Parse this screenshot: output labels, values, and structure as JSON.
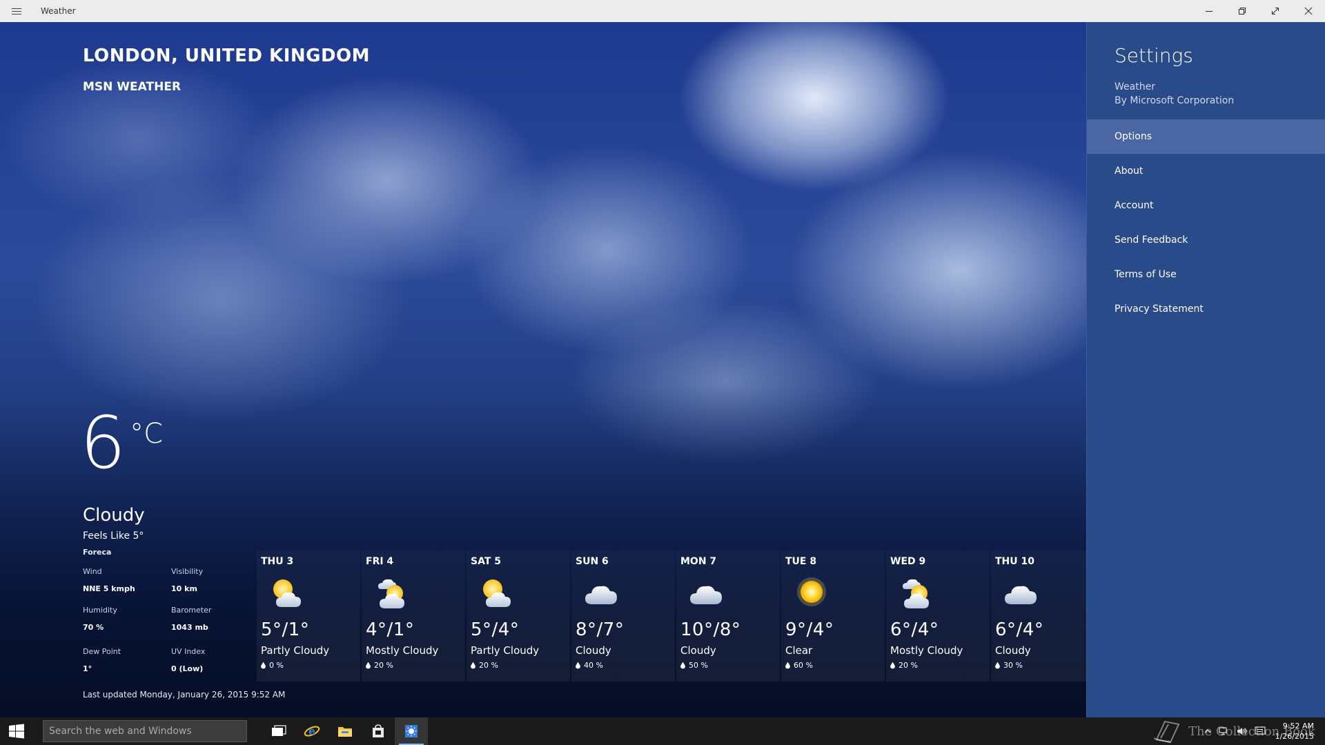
{
  "titlebar": {
    "app_title": "Weather"
  },
  "location": {
    "name": "LONDON, UNITED KINGDOM",
    "provider": "MSN WEATHER"
  },
  "current": {
    "temperature": "6",
    "unit": "°C",
    "condition": "Cloudy",
    "feels_like": "Feels Like 5°",
    "source": "Foreca",
    "details": [
      {
        "label": "Wind",
        "value": "NNE 5 kmph"
      },
      {
        "label": "Visibility",
        "value": "10 km"
      },
      {
        "label": "Humidity",
        "value": "70 %"
      },
      {
        "label": "Barometer",
        "value": "1043 mb"
      },
      {
        "label": "Dew Point",
        "value": "1°"
      },
      {
        "label": "UV Index",
        "value": "0 (Low)"
      }
    ]
  },
  "forecast": [
    {
      "day": "THU 3",
      "temp": "5°/1°",
      "condition": "Partly Cloudy",
      "precip": "0 %",
      "icon": "partly-cloudy-icon"
    },
    {
      "day": "FRI 4",
      "temp": "4°/1°",
      "condition": "Mostly Cloudy",
      "precip": "20 %",
      "icon": "mostly-cloudy-icon"
    },
    {
      "day": "SAT 5",
      "temp": "5°/4°",
      "condition": "Partly Cloudy",
      "precip": "20 %",
      "icon": "partly-cloudy-icon"
    },
    {
      "day": "SUN 6",
      "temp": "8°/7°",
      "condition": "Cloudy",
      "precip": "40 %",
      "icon": "cloudy-icon"
    },
    {
      "day": "MON 7",
      "temp": "10°/8°",
      "condition": "Cloudy",
      "precip": "50 %",
      "icon": "cloudy-icon"
    },
    {
      "day": "TUE 8",
      "temp": "9°/4°",
      "condition": "Clear",
      "precip": "60 %",
      "icon": "sun-icon"
    },
    {
      "day": "WED 9",
      "temp": "6°/4°",
      "condition": "Mostly Cloudy",
      "precip": "20 %",
      "icon": "mostly-cloudy-icon"
    },
    {
      "day": "THU 10",
      "temp": "6°/4°",
      "condition": "Cloudy",
      "precip": "30 %",
      "icon": "cloudy-icon"
    }
  ],
  "last_updated": "Last updated Monday, January 26, 2015 9:52 AM",
  "settings": {
    "title": "Settings",
    "app_name": "Weather",
    "publisher": "By Microsoft Corporation",
    "menu": [
      {
        "label": "Options",
        "selected": true
      },
      {
        "label": "About",
        "selected": false
      },
      {
        "label": "Account",
        "selected": false
      },
      {
        "label": "Send Feedback",
        "selected": false
      },
      {
        "label": "Terms of Use",
        "selected": false
      },
      {
        "label": "Privacy Statement",
        "selected": false
      }
    ]
  },
  "taskbar": {
    "search_placeholder": "Search the web and Windows",
    "watermark": "The Collection Book",
    "time": "9:52 AM",
    "date": "1/26/2015"
  },
  "colors": {
    "settings_bg": "#2a4b8a",
    "settings_selected": "#4a67a3",
    "taskbar_bg": "#1a1a1a"
  }
}
